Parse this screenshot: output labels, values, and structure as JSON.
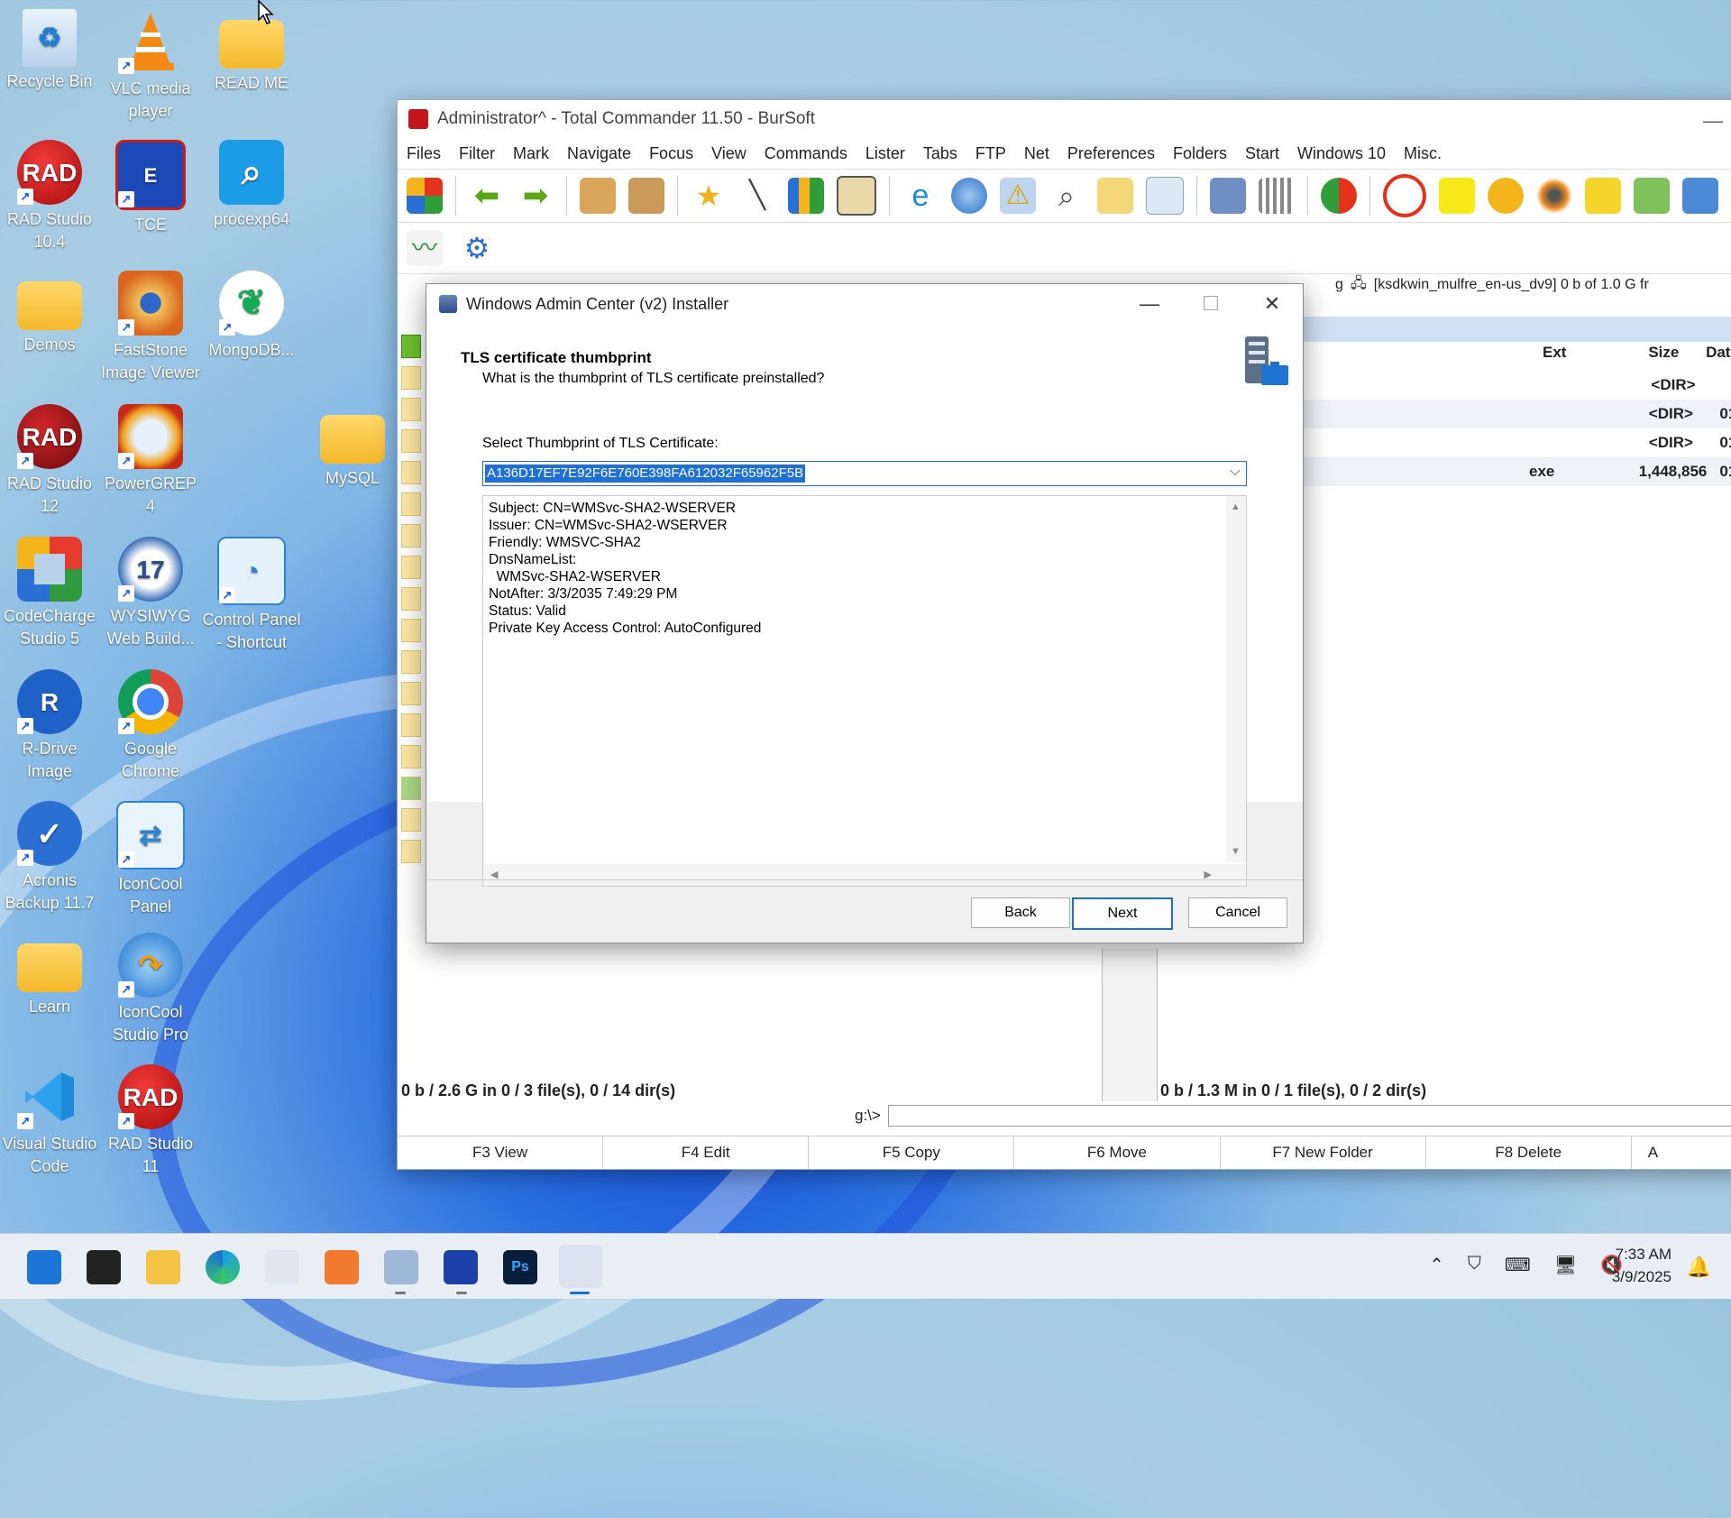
{
  "desktop": {
    "icons": [
      {
        "label": "Recycle Bin"
      },
      {
        "label": "VLC media player"
      },
      {
        "label": "READ ME"
      },
      {
        "label": "RAD Studio 10.4"
      },
      {
        "label": "TCE"
      },
      {
        "label": "procexp64"
      },
      {
        "label": "Demos"
      },
      {
        "label": "FastStone Image Viewer"
      },
      {
        "label": "MongoDB..."
      },
      {
        "label": "RAD Studio 12"
      },
      {
        "label": "PowerGREP 4"
      },
      {
        "label": "MySQL"
      },
      {
        "label": "CodeCharge Studio 5"
      },
      {
        "label": "WYSIWYG Web Build..."
      },
      {
        "label": "Control Panel - Shortcut"
      },
      {
        "label": "R-Drive Image"
      },
      {
        "label": "Google Chrome"
      },
      {
        "label": "Acronis Backup 11.7"
      },
      {
        "label": "IconCool Panel"
      },
      {
        "label": "Learn"
      },
      {
        "label": "IconCool Studio Pro"
      },
      {
        "label": "Visual Studio Code"
      },
      {
        "label": "RAD Studio 11"
      }
    ]
  },
  "tc": {
    "title": "Administrator^ - Total Commander 11.50 - BurSoft",
    "menu": [
      "Files",
      "Filter",
      "Mark",
      "Navigate",
      "Focus",
      "View",
      "Commands",
      "Lister",
      "Tabs",
      "FTP",
      "Net",
      "Preferences",
      "Folders",
      "Start",
      "Windows 10",
      "Misc."
    ],
    "right_path": "[ksdkwin_mulfre_en-us_dv9]  0 b of 1.0 G fr",
    "right_drive": "g",
    "right_cols": {
      "ext": "Ext",
      "size": "Size",
      "date": "Dat"
    },
    "right_rows": [
      {
        "ext": "",
        "size": "<DIR>",
        "date": ""
      },
      {
        "ext": "",
        "size": "<DIR>",
        "date": "01/"
      },
      {
        "ext": "",
        "size": "<DIR>",
        "date": "01/"
      },
      {
        "ext": "exe",
        "size": "1,448,856",
        "date": "01/"
      }
    ],
    "left_status": "0 b / 2.6 G in 0 / 3 file(s), 0 / 14 dir(s)",
    "right_status": "0 b / 1.3 M in 0 / 1 file(s), 0 / 2 dir(s)",
    "cmd_prompt": "g:\\>",
    "fkeys": [
      "F3 View",
      "F4 Edit",
      "F5 Copy",
      "F6 Move",
      "F7 New Folder",
      "F8 Delete",
      "A"
    ]
  },
  "dialog": {
    "title": "Windows Admin Center (v2) Installer",
    "header_title": "TLS certificate thumbprint",
    "header_sub": "What is the thumbprint of TLS certificate preinstalled?",
    "select_label": "Select Thumbprint of TLS Certificate:",
    "thumbprint": "A136D17EF7E92F6E760E398FA612032F65962F5B",
    "details": "Subject: CN=WMSvc-SHA2-WSERVER\nIssuer: CN=WMSvc-SHA2-WSERVER\nFriendly: WMSVC-SHA2\nDnsNameList:\n  WMSvc-SHA2-WSERVER\nNotAfter: 3/3/2035 7:49:29 PM\nStatus: Valid\nPrivate Key Access Control: AutoConfigured",
    "back": "Back",
    "next": "Next",
    "cancel": "Cancel"
  },
  "taskbar": {
    "time": "7:33 AM",
    "date": "3/9/2025"
  }
}
